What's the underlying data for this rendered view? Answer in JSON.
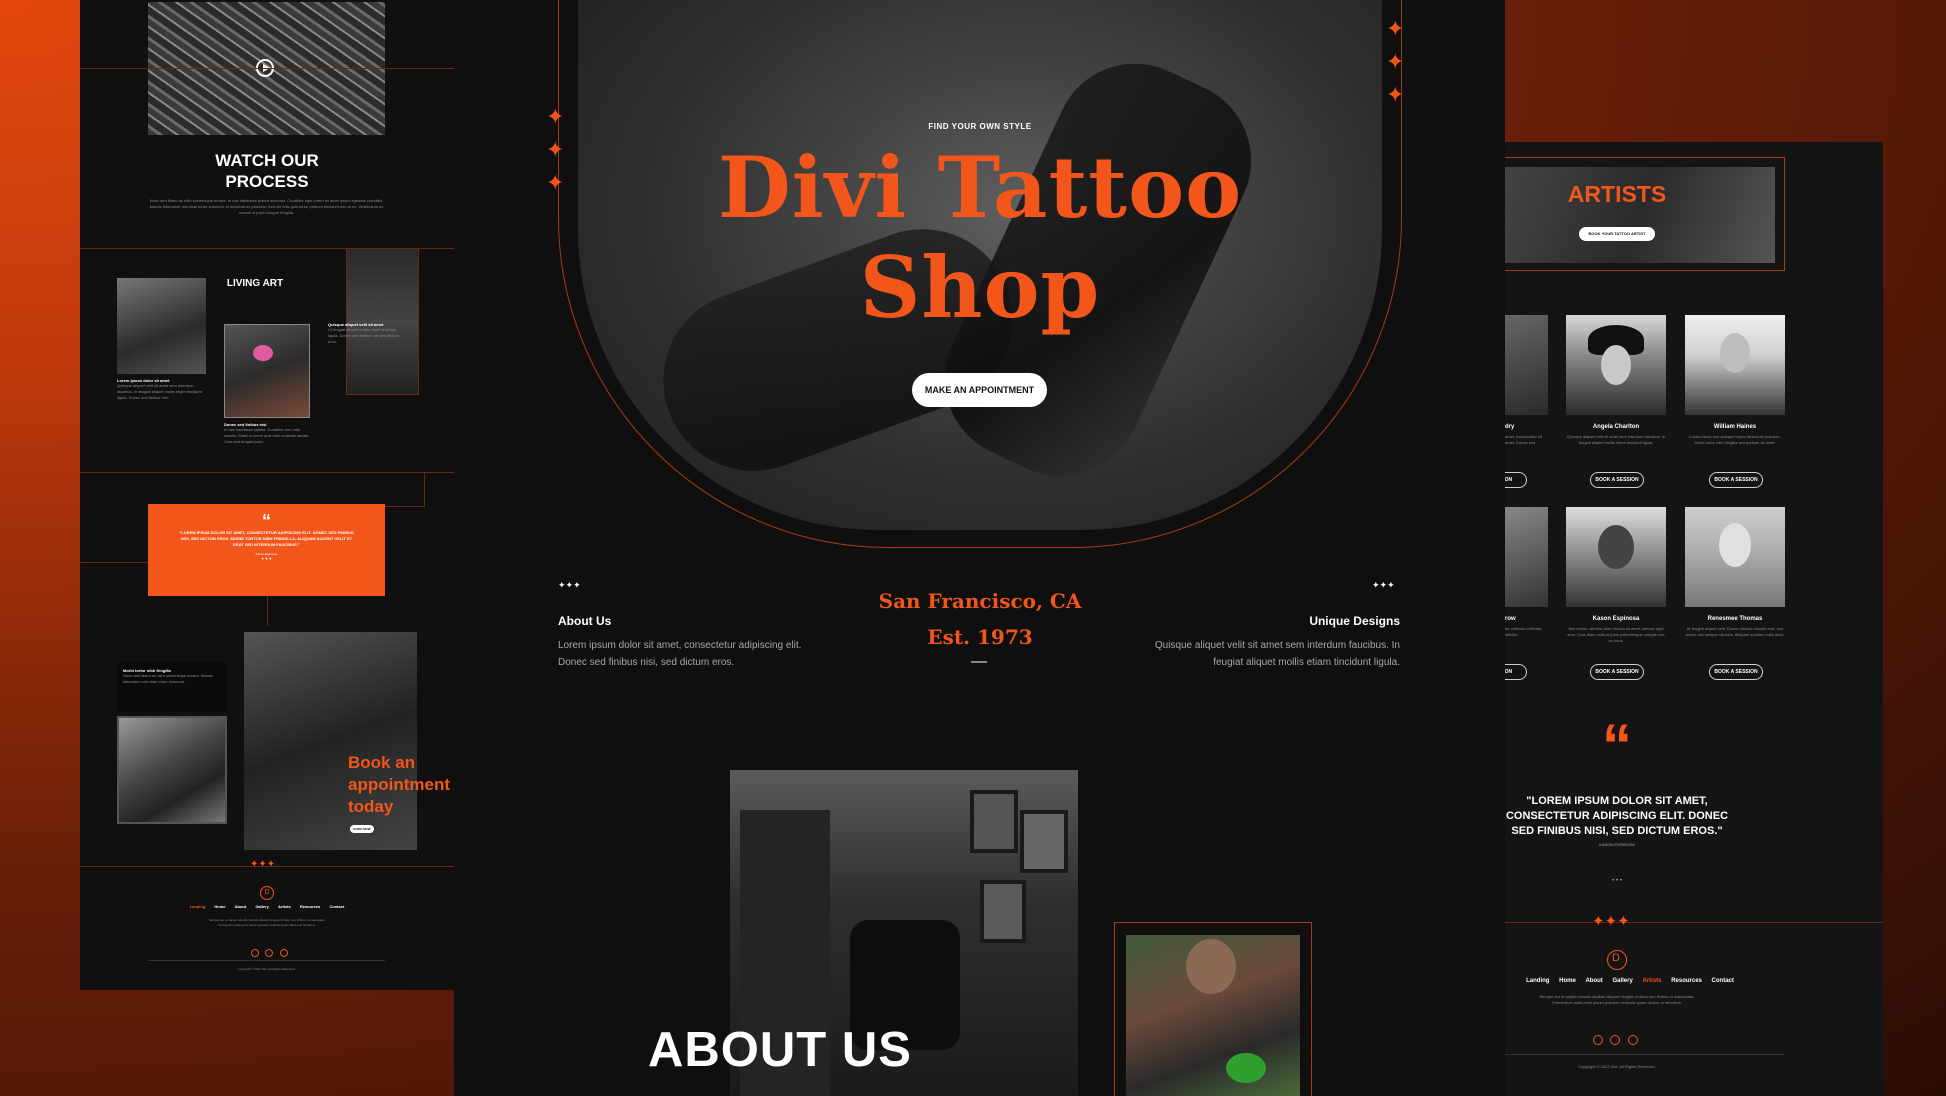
{
  "left": {
    "watch_title_1": "WATCH OUR",
    "watch_title_2": "PROCESS",
    "watch_body": "Nunc sed libero ac nibh scelerisque ornare. In hac habitasse platea dictumst. Curabitur eget lorem sit amet ipsum egestas convallis. Mauris bibendum nisl vitae tortor euismod, in tincidunt ex placerat. Sed vel felis quis tortor pretium tincidunt nec at ex. Vestibulum ac mauris id justo congue fringilla.",
    "living_art": "LIVING ART",
    "card1_title": "Lorem ipsum dolor sit amet",
    "card1_body": "Quisque aliquet velit sit amet sem interdum faucibus. In feugiat aliquet mollis etiam tincidunt ligula. Donec sed finibus nisi.",
    "card2_title": "Donec sed finibus nisi",
    "card2_body": "In hac habitasse platea. Curabitur nec odio mauris. Etiam a lorem quis nibh molestie iaculis. Cras sed feugiat justo.",
    "card3_title": "Quisque aliquet velit sit amet",
    "card3_body": "Ut feugiat aliquet mollis etiam tincidunt ligula. Donec sed finibus nisi sed dictum eros.",
    "quote_mark": "“",
    "quote_text": "\"LOREM IPSUM DOLOR SIT AMET, CONSECTETUR ADIPISCING ELIT. DONEC SED FINIBUS NISI, SED DICTUM EROS. MORBI TORTOR NIBH FRINGILLA, ALIQUAM AUCENT VELIT ET ERAT SED INTERDUM FAUCIBUS.\"",
    "quote_author": "Kason Espinosa",
    "morbi_title": "Morbi tortor nibh fringilla",
    "morbi_body": "Nunc sed libero ac nibh scelerisque ornare. Mauris bibendum nisl vitae tortor euismod.",
    "book_title": "Book an appointment today",
    "book_btn": "BOOK NOW",
    "nav": [
      "Landing",
      "Home",
      "About",
      "Gallery",
      "Artists",
      "Resources",
      "Contact"
    ],
    "footer_body": "Semper leo et sapien lobortis facilisis aliquam feugiat ut diam non finibus ut malesuada. Fermentum nulla enim ipsum posuere vehicula quam dictum at hendrerit.",
    "copyright": "Copyright © 2022 Divi. All Rights Reserved."
  },
  "center": {
    "eyebrow": "FIND YOUR OWN STYLE",
    "title_line1": "Divi Tattoo",
    "title_line2": "Shop",
    "cta": "MAKE AN APPOINTMENT",
    "about_heading": "About Us",
    "about_body": "Lorem ipsum dolor sit amet, consectetur adipiscing elit. Donec sed finibus nisi, sed dictum eros.",
    "location": "San Francisco, CA",
    "established": "Est. 1973",
    "unique_heading": "Unique Designs",
    "unique_body": "Quisque aliquet velit sit amet sem interdum faucibus. In feugiat aliquet mollis etiam tincidunt ligula.",
    "about_big": "ABOUT US"
  },
  "right": {
    "artists_title": "ARTISTS",
    "artists_btn": "BOOK YOUR TATTOO ARTIST",
    "artists": [
      {
        "name": "dry",
        "bio": "amet, consectetur sit amet. Donec sed",
        "btn": "SION"
      },
      {
        "name": "Angela Charlton",
        "bio": "Quisque aliquet velit sit amet sem interdum faucibus. In feugiat aliquet mollis etiam tincidunt ligula.",
        "btn": "BOOK A SESSION"
      },
      {
        "name": "William Haines",
        "bio": "Luctus lacus non quisque turpis bibendum posuere. Morbi tortor nibh fringilla sed pretium sit amet.",
        "btn": "BOOK A SESSION"
      },
      {
        "name": "row",
        "bio": "tur vehicula vehicula efficitur",
        "btn": "SION"
      },
      {
        "name": "Kason Espinosa",
        "bio": "Nisl metus, ultrices vitae viverra sit amet, ultrices eget sem. Cras diam nulla et justo pellentesque congue nec eu risus.",
        "btn": "BOOK A SESSION"
      },
      {
        "name": "Renesmee Thomas",
        "bio": "At feugiat aliquet velit. Donec ultrices lobortis erat, non auctor nisi semper ultricies. Aliquam sodales nulla dolor.",
        "btn": "BOOK A SESSION"
      }
    ],
    "quote_mark": "“",
    "quote_text": "\"LOREM IPSUM DOLOR SIT AMET, CONSECTETUR ADIPISCING ELIT. DONEC SED FINIBUS NISI, SED DICTUM EROS.\"",
    "quote_author": "KASON ESPINOSA",
    "nav": [
      "Landing",
      "Home",
      "About",
      "Gallery",
      "Artists",
      "Resources",
      "Contact"
    ],
    "footer_body": "Semper leo et sapien lobortis facilisis aliquam feugiat ut diam non finibus ut malesuada. Fermentum nulla enim ipsum posuere vehicula quam dictum at hendrerit.",
    "copyright": "Copyright © 2022 Divi. All Rights Reserved."
  },
  "colors": {
    "accent": "#f2561b",
    "panel": "#101010"
  }
}
